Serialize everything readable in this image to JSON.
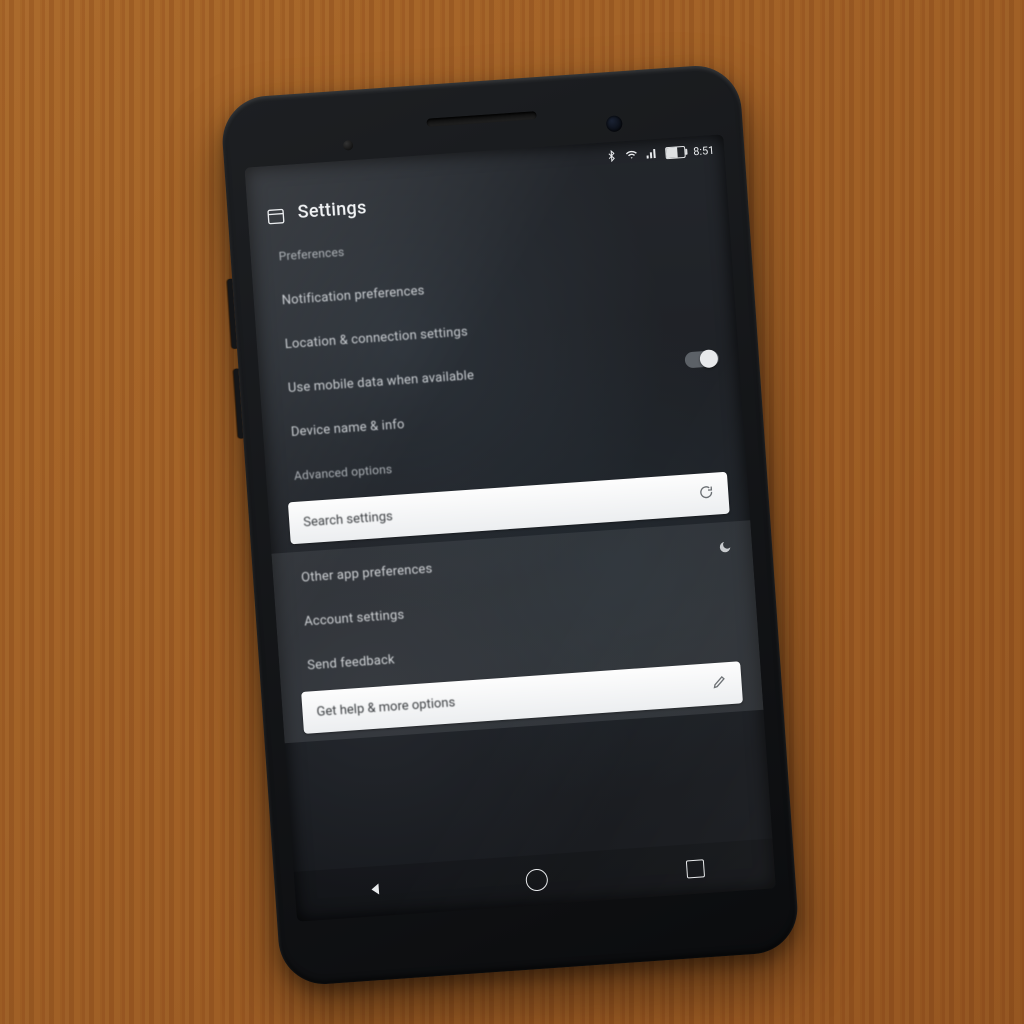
{
  "status": {
    "time": "8:51"
  },
  "header": {
    "title": "Settings"
  },
  "items": {
    "r1": "Preferences",
    "r2": "Notification preferences",
    "r3": "Location & connection settings",
    "r4": "Use mobile data when available",
    "r5": "Device name & info",
    "r6": "Advanced options"
  },
  "bar1": {
    "label": "Search settings"
  },
  "lower": {
    "l1": "Other app preferences",
    "l2": "Account settings",
    "l3": "Send feedback"
  },
  "bar2": {
    "label": "Get help & more options"
  }
}
